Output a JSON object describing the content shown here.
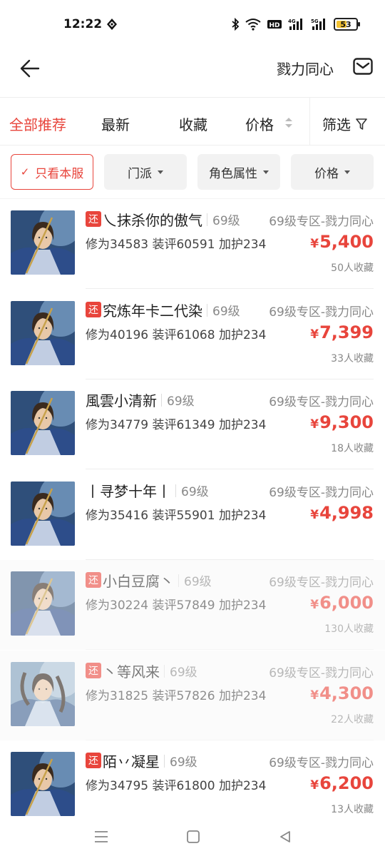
{
  "status_bar": {
    "time": "12:22",
    "battery": "53",
    "battery_level": 0.53,
    "icons": [
      "location-icon",
      "bluetooth-icon",
      "wifi-icon",
      "hd-icon",
      "4g-signal-icon",
      "5g-signal-icon",
      "battery-icon"
    ]
  },
  "header": {
    "server_name": "戮力同心",
    "back_icon": "back-arrow-icon",
    "mail_icon": "mail-icon"
  },
  "tabs": {
    "recommend": "全部推荐",
    "newest": "最新",
    "favorites": "收藏",
    "price": "价格",
    "filter": "筛选"
  },
  "chips": {
    "this_server": "只看本服",
    "sect": "门派",
    "attribute": "角色属性",
    "price": "价格"
  },
  "colors": {
    "accent": "#e8453c",
    "tag_bg": "#e8453c"
  },
  "listings": [
    {
      "tag": "还",
      "name": "乀抹杀你的傲气",
      "level": "69级",
      "zone": "69级专区-戮力同心",
      "stats": "修为34583 装评60591 加护234",
      "price": "5,400",
      "favorites": "50人收藏",
      "faded": false,
      "avatar": "male"
    },
    {
      "tag": "还",
      "name": "究炼年卡二代染",
      "level": "69级",
      "zone": "69级专区-戮力同心",
      "stats": "修为40196 装评61068 加护234",
      "price": "7,399",
      "favorites": "33人收藏",
      "faded": false,
      "avatar": "male"
    },
    {
      "tag": "",
      "name": "風雲小清新",
      "level": "69级",
      "zone": "69级专区-戮力同心",
      "stats": "修为34779 装评61349 加护234",
      "price": "9,300",
      "favorites": "18人收藏",
      "faded": false,
      "avatar": "male"
    },
    {
      "tag": "",
      "name": "丨寻梦十年丨",
      "level": "69级",
      "zone": "69级专区-戮力同心",
      "stats": "修为35416 装评55901 加护234",
      "price": "4,998",
      "favorites": "",
      "faded": false,
      "avatar": "male"
    },
    {
      "tag": "还",
      "name": "小白豆腐丶",
      "level": "69级",
      "zone": "69级专区-戮力同心",
      "stats": "修为30224 装评57849 加护234",
      "price": "6,000",
      "favorites": "130人收藏",
      "faded": true,
      "avatar": "male"
    },
    {
      "tag": "还",
      "name": "丶等风来",
      "level": "69级",
      "zone": "69级专区-戮力同心",
      "stats": "修为31825 装评57826 加护234",
      "price": "4,300",
      "favorites": "22人收藏",
      "faded": true,
      "avatar": "female"
    },
    {
      "tag": "还",
      "name": "陌丷凝星",
      "level": "69级",
      "zone": "69级专区-戮力同心",
      "stats": "修为34795 装评61800 加护234",
      "price": "6,200",
      "favorites": "13人收藏",
      "faded": false,
      "avatar": "male"
    }
  ],
  "currency_symbol": "¥",
  "navbar": {
    "icons": [
      "menu-icon",
      "home-square-icon",
      "back-triangle-icon"
    ]
  }
}
